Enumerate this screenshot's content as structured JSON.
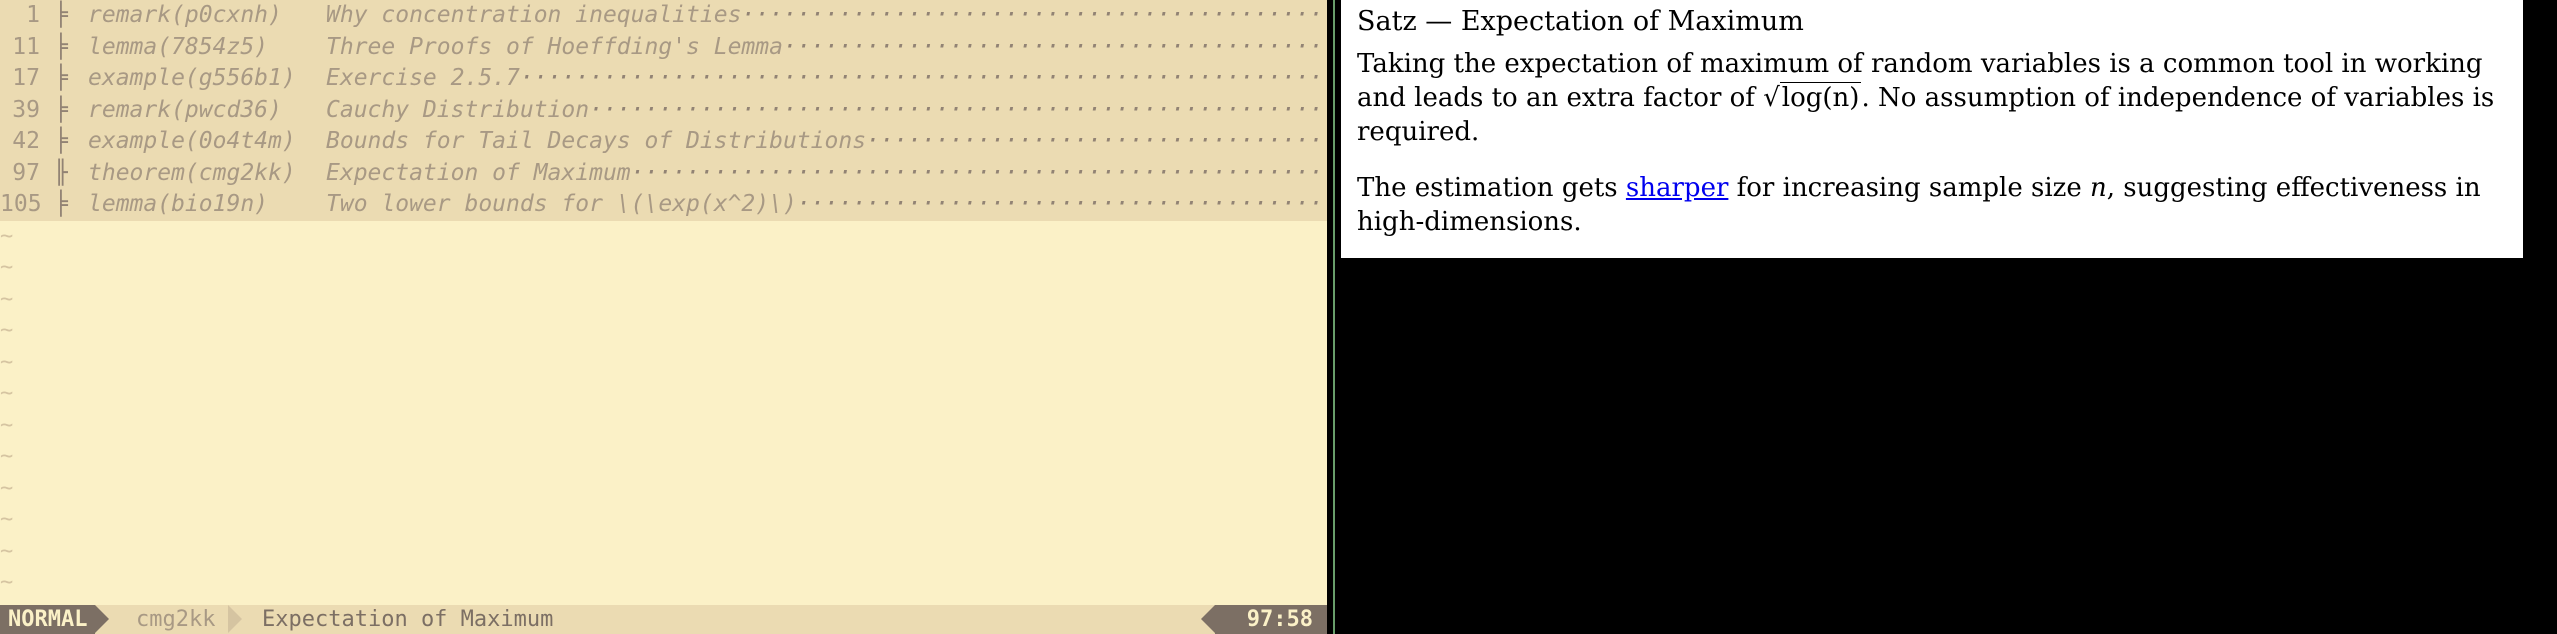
{
  "outline": [
    {
      "line": "1",
      "kind": "remark(p0cxnh)",
      "title": "Why concentration inequalities"
    },
    {
      "line": "11",
      "kind": "lemma(7854z5)",
      "title": "Three Proofs of Hoeffding's Lemma"
    },
    {
      "line": "17",
      "kind": "example(g556b1)",
      "title": "Exercise 2.5.7"
    },
    {
      "line": "39",
      "kind": "remark(pwcd36)",
      "title": "Cauchy Distribution"
    },
    {
      "line": "42",
      "kind": "example(0o4t4m)",
      "title": "Bounds for Tail Decays of Distributions"
    },
    {
      "line": "97",
      "kind": "theorem(cmg2kk)",
      "title": "Expectation of Maximum"
    },
    {
      "line": "105",
      "kind": "lemma(bio19n)",
      "title": "Two lower bounds for \\(\\exp(x^2)\\)"
    }
  ],
  "statusline": {
    "mode": "NORMAL",
    "id": "cmg2kk",
    "title": "Expectation of Maximum",
    "position": "97:58"
  },
  "popup": {
    "title": "Satz — Expectation of Maximum",
    "p1_a": "Taking the expectation of maximum of random variables is a common tool in working and leads to an extra factor of ",
    "p1_math": "log(n)",
    "p1_b": ". No assumption of independence of variables is required.",
    "p2_a": "The estimation gets ",
    "p2_link": "sharper",
    "p2_b": " for increasing sample size ",
    "p2_math": "n",
    "p2_c": ", suggesting effectiveness in high-dimensions."
  },
  "colors": {
    "editor_bg": "#fbf1c7",
    "highlight_bg": "#ebdbb2",
    "status_mode_bg": "#7c6f64",
    "link": "#0000ee",
    "divider": "#689d6a"
  }
}
